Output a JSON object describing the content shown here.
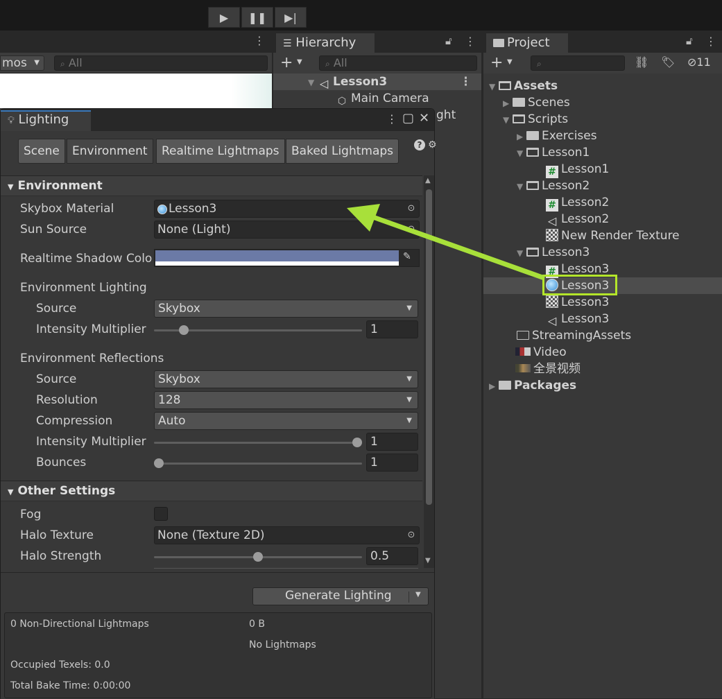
{
  "toolbar": {
    "play_icon": "play-icon",
    "pause_icon": "pause-icon",
    "step_icon": "step-icon"
  },
  "scene": {
    "gizmos_label": "mos",
    "search_placeholder": "All"
  },
  "hierarchy": {
    "tab_label": "Hierarchy",
    "search_placeholder": "All",
    "rows": [
      {
        "label": "Lesson3"
      },
      {
        "label": "Main Camera"
      },
      {
        "label": "ght"
      }
    ]
  },
  "project": {
    "tab_label": "Project",
    "hidden_count": "11",
    "tree": [
      {
        "label": "Assets"
      },
      {
        "label": "Scenes"
      },
      {
        "label": "Scripts"
      },
      {
        "label": "Exercises"
      },
      {
        "label": "Lesson1"
      },
      {
        "label": "Lesson1"
      },
      {
        "label": "Lesson2"
      },
      {
        "label": "Lesson2"
      },
      {
        "label": "Lesson2"
      },
      {
        "label": "New Render Texture"
      },
      {
        "label": "Lesson3"
      },
      {
        "label": "Lesson3"
      },
      {
        "label": "Lesson3"
      },
      {
        "label": "Lesson3"
      },
      {
        "label": "Lesson3"
      },
      {
        "label": "StreamingAssets"
      },
      {
        "label": "Video"
      },
      {
        "label": "全景视频"
      },
      {
        "label": "Packages"
      }
    ]
  },
  "lighting": {
    "title": "Lighting",
    "tabs": [
      "Scene",
      "Environment",
      "Realtime Lightmaps",
      "Baked Lightmaps"
    ],
    "environment_header": "Environment",
    "skybox_material_label": "Skybox Material",
    "skybox_material_value": "Lesson3",
    "sun_source_label": "Sun Source",
    "sun_source_value": "None (Light)",
    "shadow_color_label": "Realtime Shadow Colo",
    "shadow_color": "#6b7aa6",
    "env_lighting_label": "Environment Lighting",
    "source_label": "Source",
    "source_value": "Skybox",
    "intensity_label": "Intensity Multiplier",
    "intensity_value": "1",
    "intensity_fraction": 0.125,
    "env_reflections_label": "Environment Reflections",
    "refl_source_label": "Source",
    "refl_source_value": "Skybox",
    "resolution_label": "Resolution",
    "resolution_value": "128",
    "compression_label": "Compression",
    "compression_value": "Auto",
    "refl_intensity_label": "Intensity Multiplier",
    "refl_intensity_value": "1",
    "refl_intensity_fraction": 1.0,
    "bounces_label": "Bounces",
    "bounces_value": "1",
    "bounces_fraction": 0.0,
    "other_header": "Other Settings",
    "fog_label": "Fog",
    "fog_checked": false,
    "halo_texture_label": "Halo Texture",
    "halo_texture_value": "None (Texture 2D)",
    "halo_strength_label": "Halo Strength",
    "halo_strength_value": "0.5",
    "halo_strength_fraction": 0.5,
    "generate_label": "Generate Lighting",
    "stats": {
      "nondir": "0 Non-Directional Lightmaps",
      "size": "0 B",
      "no_lightmaps": "No Lightmaps",
      "occupied": "Occupied Texels: 0.0",
      "bake_time": "Total Bake Time: 0:00:00"
    }
  },
  "colors": {
    "highlight_box": "#b4e62a",
    "arrow": "#a8e03a",
    "selection": "#4d4d4d"
  }
}
